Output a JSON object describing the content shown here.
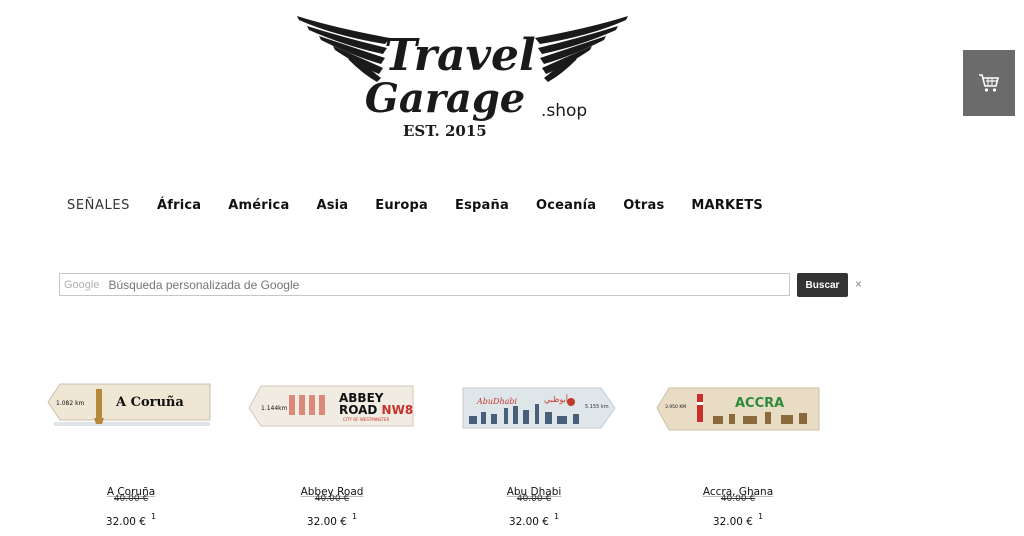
{
  "logo": {
    "line1": "Travel",
    "line2": "Garage",
    "suffix": ".shop",
    "est": "EST. 2015",
    "icon": "winged-logo"
  },
  "cart": {
    "icon": "shopping-cart-icon"
  },
  "nav": {
    "items": [
      "SEÑALES",
      "África",
      "América",
      "Asia",
      "Europa",
      "España",
      "Oceanía",
      "Otras",
      "MARKETS"
    ]
  },
  "search": {
    "brand": "Google",
    "placeholder": "Búsqueda personalizada de Google",
    "button_label": "Buscar",
    "clear_label": "×"
  },
  "products": [
    {
      "name": "A Coruña",
      "old_price": "40.00 €",
      "price": "32.00 €",
      "badge": "1",
      "sign_text": "A Coruña",
      "distance": "1.082 km",
      "colors": {
        "accent": "#111111",
        "bg": "#efe6d3"
      }
    },
    {
      "name": "Abbey Road",
      "old_price": "40.00 €",
      "price": "32.00 €",
      "badge": "1",
      "sign_text": "ABBEY ROAD",
      "sign_sub": "NW8",
      "sign_small": "CITY OF WESTMINSTER",
      "distance": "1.144km",
      "colors": {
        "accent": "#c8302b",
        "bg": "#f1ece2"
      }
    },
    {
      "name": "Abu Dhabi",
      "old_price": "40.00 €",
      "price": "32.00 €",
      "badge": "1",
      "sign_text": "AbuDhabi",
      "sign_arabic": "أبوظبي",
      "distance": "5.155 km",
      "colors": {
        "accent": "#c0392b",
        "bg": "#dfe6ea"
      }
    },
    {
      "name": "Accra, Ghana",
      "old_price": "40.00 €",
      "price": "32.00 €",
      "badge": "1",
      "sign_text": "ACCRA",
      "distance": "3.950 KM",
      "colors": {
        "accent": "#2e8b3a",
        "bg": "#e8dcc4"
      }
    }
  ]
}
